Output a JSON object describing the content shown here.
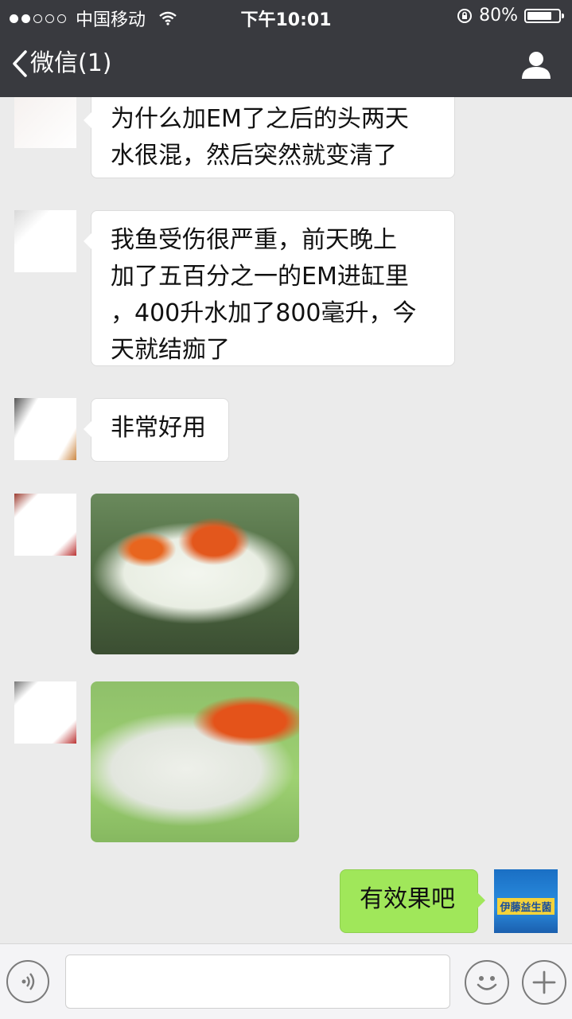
{
  "status_bar": {
    "signal_dots_filled": 2,
    "signal_dots_total": 5,
    "carrier": "中国移动",
    "time": "下午10:01",
    "battery": "80%",
    "battery_level": 0.8
  },
  "nav": {
    "back_label": "微信(1)",
    "back_icon": "chevron-left-icon",
    "contact_icon": "person-icon"
  },
  "messages": [
    {
      "side": "left",
      "type": "text",
      "text_lines": [
        "为什么加EM了之后的头两天",
        "水很混，然后突然就变清了"
      ]
    },
    {
      "side": "left",
      "type": "text",
      "text_lines": [
        "我鱼受伤很严重，前天晚上",
        "加了五百分之一的EM进缸里",
        "，400升水加了800毫升，今",
        "天就结痂了"
      ]
    },
    {
      "side": "left",
      "type": "text",
      "text_lines": [
        "非常好用"
      ]
    },
    {
      "side": "left",
      "type": "image"
    },
    {
      "side": "left",
      "type": "image"
    },
    {
      "side": "right",
      "type": "text",
      "text_lines": [
        "有效果吧"
      ]
    }
  ],
  "my_avatar": {
    "brand_text": "伊藤益生菌"
  },
  "input_bar": {
    "voice_icon": "voice-icon",
    "emoji_icon": "emoji-icon",
    "plus_icon": "plus-icon"
  },
  "colors": {
    "nav_bg": "#393a3f",
    "chat_bg": "#ebebeb",
    "my_bubble": "#a0e75a",
    "other_bubble": "#ffffff"
  }
}
